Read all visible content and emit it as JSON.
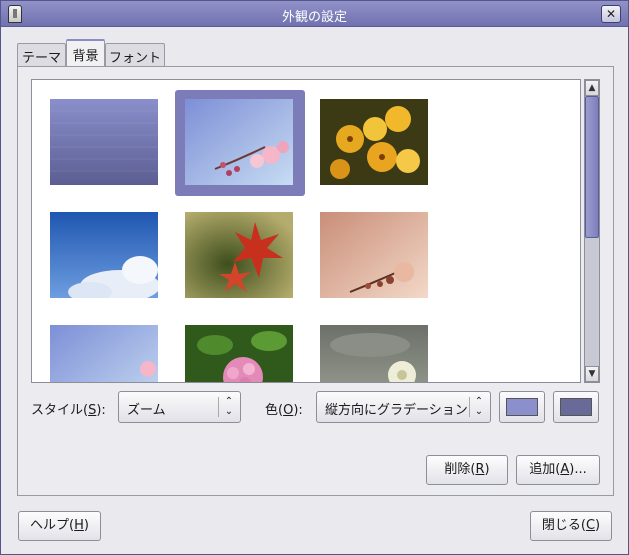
{
  "window": {
    "title": "外観の設定",
    "close_glyph": "✕"
  },
  "tabs": [
    {
      "label": "テーマ",
      "active": false
    },
    {
      "label": "背景",
      "active": true
    },
    {
      "label": "フォント",
      "active": false
    }
  ],
  "gallery": {
    "selected_index": 1,
    "items": [
      {
        "icon": "wallpaper-blue-gradient"
      },
      {
        "icon": "wallpaper-cherry-blossom-blue"
      },
      {
        "icon": "wallpaper-yellow-pansies"
      },
      {
        "icon": "wallpaper-blue-sky-clouds"
      },
      {
        "icon": "wallpaper-red-maple-leaves"
      },
      {
        "icon": "wallpaper-plum-blossom-peach"
      },
      {
        "icon": "wallpaper-cherry-blossom-sky"
      },
      {
        "icon": "wallpaper-pink-hydrangea"
      },
      {
        "icon": "wallpaper-white-flower-gray"
      }
    ]
  },
  "style": {
    "label_prefix": "スタイル(",
    "accel": "S",
    "label_suffix": "):",
    "value": "ズーム"
  },
  "color": {
    "label_prefix": "色(",
    "accel": "O",
    "label_suffix": "):",
    "value": "縦方向にグラデーション",
    "primary": "#8b8fcb",
    "secondary": "#6a6a98"
  },
  "buttons": {
    "delete_prefix": "削除(",
    "delete_accel": "R",
    "delete_suffix": ")",
    "add_prefix": "追加(",
    "add_accel": "A",
    "add_suffix": ")...",
    "help_prefix": "ヘルプ(",
    "help_accel": "H",
    "help_suffix": ")",
    "close_prefix": "閉じる(",
    "close_accel": "C",
    "close_suffix": ")"
  },
  "colors": {
    "titlebar": "#7a7bb8",
    "selection": "#7b7cb8",
    "scroll_thumb": "#8c8dc4"
  }
}
